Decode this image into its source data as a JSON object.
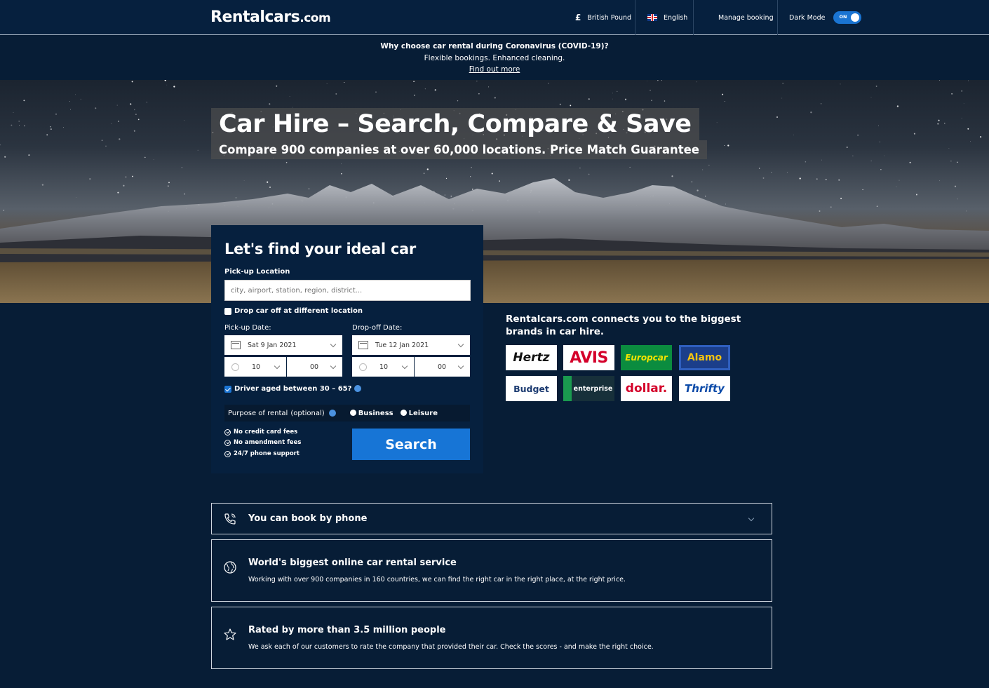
{
  "header": {
    "logo_main": "Rentalcars",
    "logo_suffix": ".com",
    "currency_symbol": "£",
    "currency": "British Pound",
    "language": "English",
    "manage_booking": "Manage booking",
    "dark_mode_label": "Dark Mode",
    "dark_mode_toggle": "ON"
  },
  "covid_banner": {
    "heading": "Why choose car rental during Coronavirus (COVID-19)?",
    "text": "Flexible bookings. Enhanced cleaning.",
    "link": "Find out more"
  },
  "hero": {
    "title": "Car Hire – Search, Compare & Save",
    "subtitle": "Compare 900 companies at over 60,000 locations. Price Match Guarantee"
  },
  "search_form": {
    "heading": "Let's find your ideal car",
    "pickup_location_label": "Pick-up Location",
    "pickup_location_placeholder": "city, airport, station, region, district...",
    "drop_off_different_label": "Drop car off at different location",
    "drop_off_different_checked": false,
    "pickup_date_label": "Pick-up Date:",
    "pickup_date": "Sat 9 Jan 2021",
    "pickup_hour": "10",
    "pickup_minute": "00",
    "dropoff_date_label": "Drop-off Date:",
    "dropoff_date": "Tue 12 Jan 2021",
    "dropoff_hour": "10",
    "dropoff_minute": "00",
    "driver_age_label": "Driver aged between 30 – 65?",
    "driver_age_checked": true,
    "purpose_label": "Purpose of rental",
    "purpose_optional": "(optional)",
    "purpose_options": [
      "Business",
      "Leisure"
    ],
    "perks": [
      "No credit card fees",
      "No amendment fees",
      "24/7 phone support"
    ],
    "search_button": "Search"
  },
  "brands": {
    "heading": "Rentalcars.com connects you to the biggest brands in car hire.",
    "items": [
      "Hertz",
      "AVIS",
      "Europcar",
      "Alamo",
      "Budget",
      "enterprise",
      "dollar.",
      "Thrifty"
    ]
  },
  "info_cards": [
    {
      "icon": "phone-icon",
      "title": "You can book by phone",
      "text": ""
    },
    {
      "icon": "globe-icon",
      "title": "World's biggest online car rental service",
      "text": "Working with over 900 companies in 160 countries, we can find the right car in the right place, at the right price."
    },
    {
      "icon": "star-icon",
      "title": "Rated by more than 3.5 million people",
      "text": "We ask each of our customers to rate the company that provided their car. Check the scores - and make the right choice."
    }
  ],
  "colors": {
    "background": "#071d36",
    "header": "#06203e",
    "accent": "#1775d6"
  }
}
